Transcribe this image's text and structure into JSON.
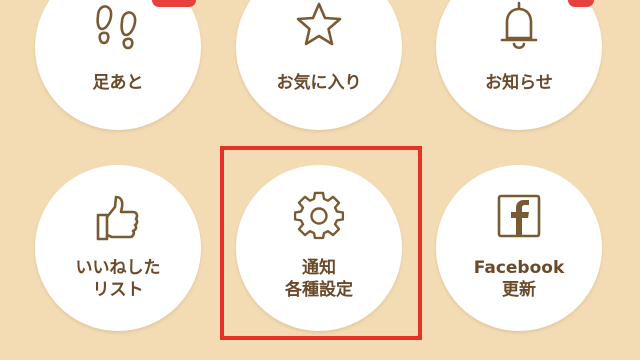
{
  "menu": {
    "items": [
      {
        "id": "footprints",
        "label_lines": [
          "足あと"
        ],
        "icon": "footprints-icon",
        "badge": true
      },
      {
        "id": "favorites",
        "label_lines": [
          "お気に入り"
        ],
        "icon": "star-icon",
        "badge": false
      },
      {
        "id": "notices",
        "label_lines": [
          "お知らせ"
        ],
        "icon": "bell-icon",
        "badge": true
      },
      {
        "id": "like-list",
        "label_lines": [
          "いいねした",
          "リスト"
        ],
        "icon": "thumbs-up-icon",
        "badge": false
      },
      {
        "id": "notification-settings",
        "label_lines": [
          "通知",
          "各種設定"
        ],
        "icon": "gear-icon",
        "badge": false,
        "highlighted": true
      },
      {
        "id": "facebook-update",
        "label_lines": [
          "Facebook",
          "更新"
        ],
        "icon": "facebook-icon",
        "badge": false
      }
    ]
  },
  "colors": {
    "background": "#f3dcb4",
    "tile": "#ffffff",
    "text": "#6b4a2b",
    "icon_stroke": "#7a5a35",
    "badge": "#e8413b",
    "highlight": "#e53226"
  }
}
